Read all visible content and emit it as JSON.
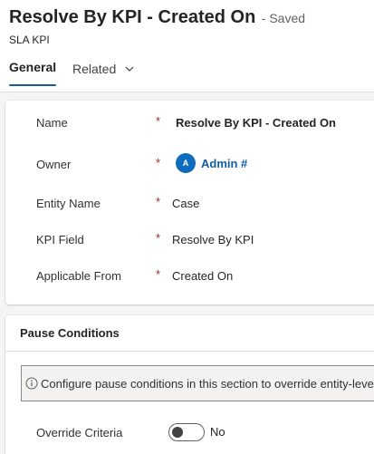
{
  "header": {
    "title": "Resolve By KPI - Created On",
    "saved_status": "- Saved",
    "entity_type": "SLA KPI"
  },
  "tabs": [
    {
      "label": "General",
      "selected": true
    },
    {
      "label": "Related",
      "selected": false
    }
  ],
  "form": {
    "required_marker": "*",
    "fields": [
      {
        "label": "Name",
        "value": "Resolve By KPI - Created On"
      },
      {
        "label": "Owner",
        "value": "Admin #",
        "avatar_initial": "A"
      },
      {
        "label": "Entity Name",
        "value": "Case"
      },
      {
        "label": "KPI Field",
        "value": "Resolve By KPI"
      },
      {
        "label": "Applicable From",
        "value": "Created On"
      }
    ]
  },
  "pause_conditions": {
    "title": "Pause Conditions",
    "info_text": "Configure pause conditions in this section to override entity-level",
    "override_label": "Override Criteria",
    "override_value": "No",
    "override_enabled": false
  },
  "colors": {
    "accent": "#0f6cbd",
    "link": "#115ea3",
    "required": "#a4262c"
  }
}
